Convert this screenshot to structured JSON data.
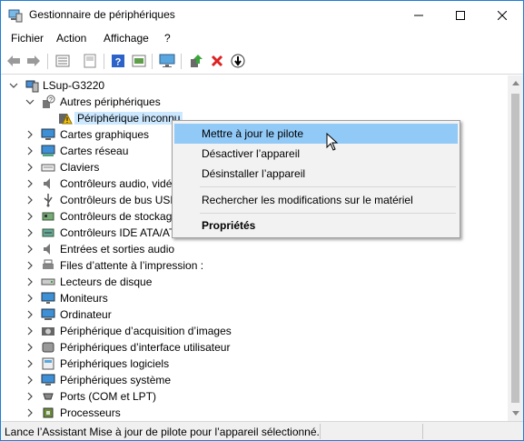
{
  "window": {
    "title": "Gestionnaire de périphériques",
    "border_color": "#1e7fd7"
  },
  "menubar": {
    "items": [
      "Fichier",
      "Action",
      "Affichage",
      "?"
    ]
  },
  "toolbar": {
    "buttons": [
      "back-icon",
      "forward-icon",
      "properties-icon",
      "view-icon",
      "help-icon",
      "update-view-icon",
      "monitor-icon",
      "update-driver-icon",
      "uninstall-icon",
      "disable-icon"
    ]
  },
  "tree": {
    "root": "LSup-G3220",
    "rows": [
      "Autres périphériques",
      "Périphérique inconnu",
      "Cartes graphiques",
      "Cartes réseau",
      "Claviers",
      "Contrôleurs audio, vidéo",
      "Contrôleurs de bus USB",
      "Contrôleurs de stockage",
      "Contrôleurs IDE ATA/ATAPI",
      "Entrées et sorties audio",
      "Files d’attente à l’impression :",
      "Lecteurs de disque",
      "Moniteurs",
      "Ordinateur",
      "Périphérique d’acquisition d’images",
      "Périphériques d’interface utilisateur",
      "Périphériques logiciels",
      "Périphériques système",
      "Ports (COM et LPT)",
      "Processeurs"
    ],
    "selected": "Périphérique inconnu",
    "selection_color": "#cce8ff"
  },
  "context_menu": {
    "items": [
      {
        "label": "Mettre à jour le pilote"
      },
      {
        "label": "Désactiver l’appareil"
      },
      {
        "label": "Désinstaller l’appareil"
      },
      {
        "label": "Rechercher les modifications sur le matériel"
      },
      {
        "label": "Propriétés"
      }
    ],
    "highlight_color": "#91c9f7"
  },
  "statusbar": {
    "text": "Lance l’Assistant Mise à jour de pilote pour l’appareil sélectionné."
  }
}
